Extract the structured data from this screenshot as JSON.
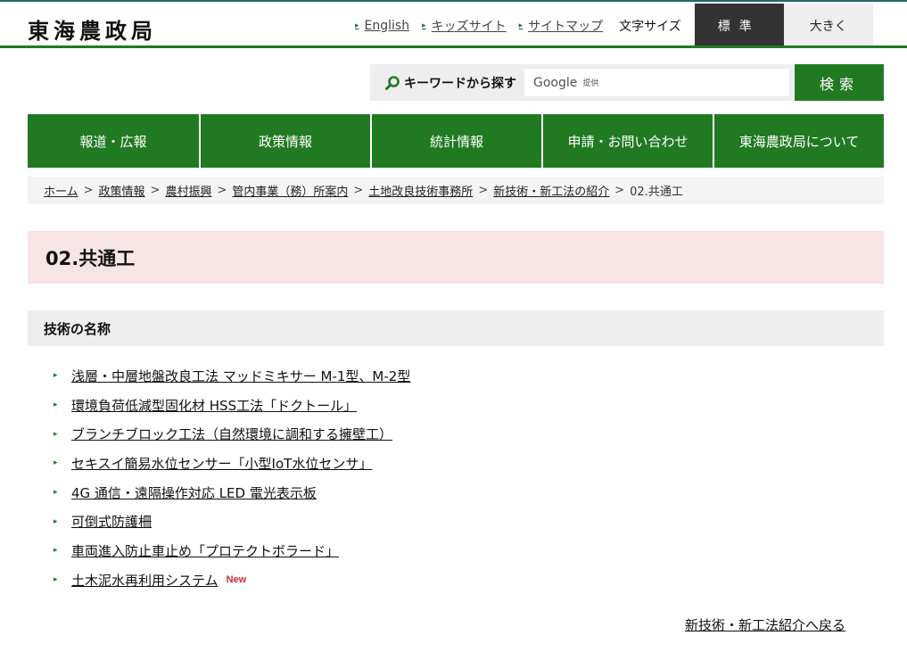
{
  "site": {
    "logo": "東海農政局"
  },
  "utility": {
    "links": [
      "English",
      "キッズサイト",
      "サイトマップ"
    ],
    "font_size_label": "文字サイズ",
    "font_size_standard": "標準",
    "font_size_large": "大きく"
  },
  "search": {
    "label": "キーワードから探す",
    "placeholder_brand": "Google",
    "placeholder_suffix": "提供",
    "button": "検索"
  },
  "gnav": [
    "報道・広報",
    "政策情報",
    "統計情報",
    "申請・お問い合わせ",
    "東海農政局について"
  ],
  "breadcrumb": {
    "links": [
      "ホーム",
      "政策情報",
      "農村振興",
      "管内事業（務）所案内",
      "土地改良技術事務所",
      "新技術・新工法の紹介"
    ],
    "current": "02.共通工",
    "separator": ">"
  },
  "page": {
    "title": "02.共通工",
    "section_heading": "技術の名称"
  },
  "items": [
    {
      "label": "浅層・中層地盤改良工法 マッドミキサー M-1型、M-2型"
    },
    {
      "label": "環境負荷低減型固化材 HSS工法「ドクトール」"
    },
    {
      "label": "ブランチブロック工法（自然環境に調和する擁壁工）"
    },
    {
      "label": "セキスイ簡易水位センサー「小型IoT水位センサ」"
    },
    {
      "label": "4G 通信・遠隔操作対応 LED 電光表示板"
    },
    {
      "label": "可倒式防護柵"
    },
    {
      "label": "車両進入防止車止め「プロテクトボラード」"
    },
    {
      "label": "土木泥水再利用システム",
      "badge": "New"
    }
  ],
  "back_link": "新技術・新工法紹介へ戻る",
  "colors": {
    "brand_green": "#217a22",
    "title_bg": "#f7e4e4",
    "new_badge": "#d0263a"
  }
}
